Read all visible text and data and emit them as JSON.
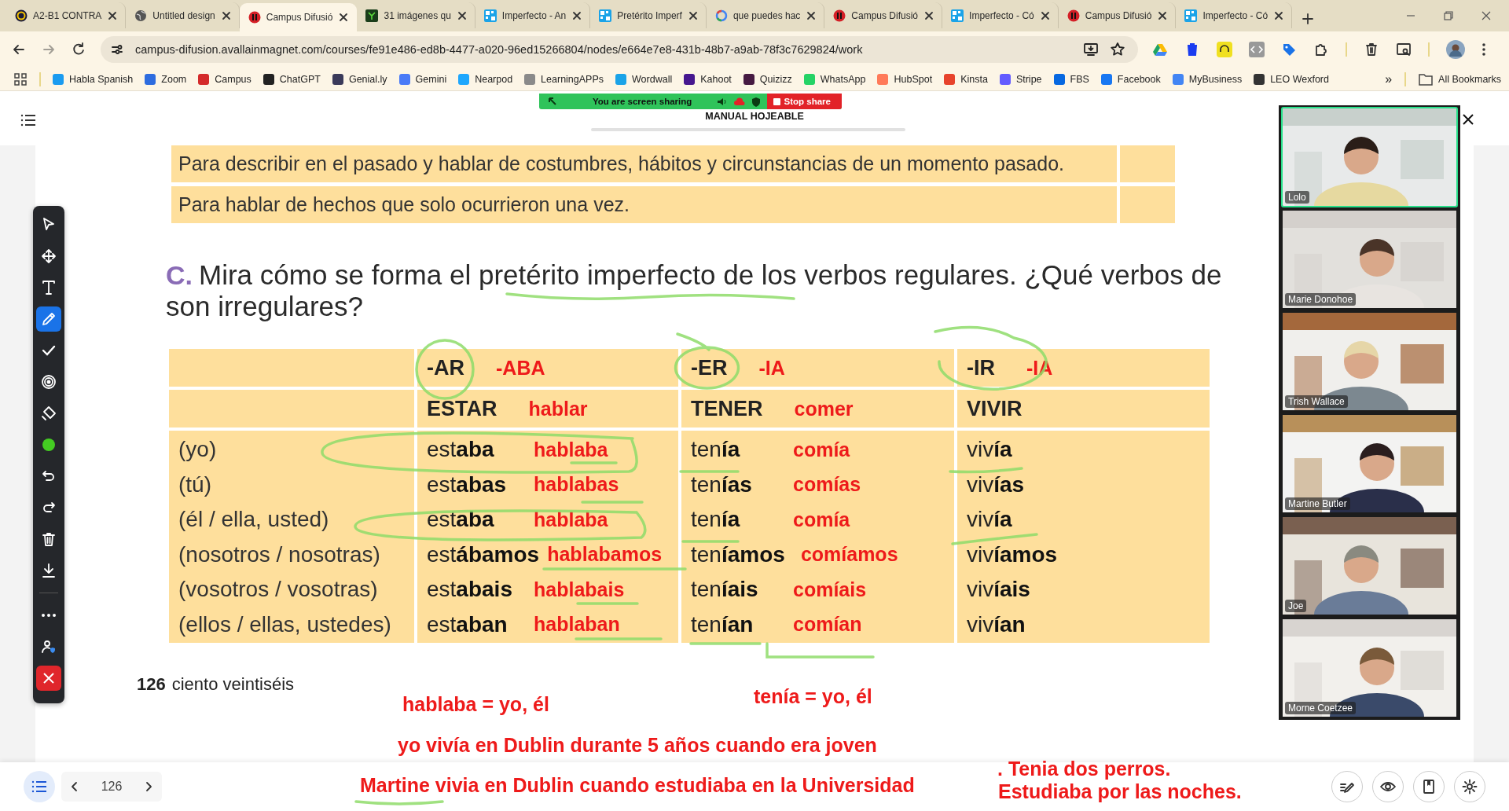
{
  "tabs": [
    {
      "title": "A2-B1 CONTRA",
      "kind": "ring",
      "selected": false
    },
    {
      "title": "Untitled design",
      "kind": "globe",
      "selected": false
    },
    {
      "title": "Campus Difusió",
      "kind": "campus",
      "selected": true
    },
    {
      "title": "31 imágenes qu",
      "kind": "network",
      "selected": false
    },
    {
      "title": "Imperfecto - An",
      "kind": "grid",
      "selected": false
    },
    {
      "title": "Pretérito Imperf",
      "kind": "grid",
      "selected": false
    },
    {
      "title": "que puedes hac",
      "kind": "search",
      "selected": false
    },
    {
      "title": "Campus Difusió",
      "kind": "campus",
      "selected": false
    },
    {
      "title": "Imperfecto - Có",
      "kind": "grid",
      "selected": false
    },
    {
      "title": "Campus Difusió",
      "kind": "campus",
      "selected": false
    },
    {
      "title": "Imperfecto - Có",
      "kind": "grid",
      "selected": false
    }
  ],
  "address_bar": {
    "url": "campus-difusion.avallainmagnet.com/courses/fe91e486-ed8b-4477-a020-96ed15266804/nodes/e664e7e8-431b-48b7-a9ab-78f3c7629824/work"
  },
  "bookmarks": [
    {
      "label": "Habla Spanish",
      "color": "#1a9bf0"
    },
    {
      "label": "Zoom",
      "color": "#2d6cdf"
    },
    {
      "label": "Campus",
      "color": "#d42a2a"
    },
    {
      "label": "ChatGPT",
      "color": "#222222"
    },
    {
      "label": "Genial.ly",
      "color": "#3a3a5a"
    },
    {
      "label": "Gemini",
      "color": "#4a7bf7"
    },
    {
      "label": "Nearpod",
      "color": "#1ea7fd"
    },
    {
      "label": "LearningAPPs",
      "color": "#8a8a8a"
    },
    {
      "label": "Wordwall",
      "color": "#1aa3e8"
    },
    {
      "label": "Kahoot",
      "color": "#46178f"
    },
    {
      "label": "Quizizz",
      "color": "#461a42"
    },
    {
      "label": "WhatsApp",
      "color": "#25d366"
    },
    {
      "label": "HubSpot",
      "color": "#ff7a59"
    },
    {
      "label": "Kinsta",
      "color": "#e7432c"
    },
    {
      "label": "Stripe",
      "color": "#635bff"
    },
    {
      "label": "FBS",
      "color": "#0668e1"
    },
    {
      "label": "Facebook",
      "color": "#1877f2"
    },
    {
      "label": "MyBusiness",
      "color": "#4285f4"
    },
    {
      "label": "LEO Wexford",
      "color": "#333333"
    }
  ],
  "bookmarks_more": "»",
  "all_bookmarks": "All Bookmarks",
  "share_bar": {
    "status": "You are screen sharing",
    "stop": "Stop share"
  },
  "viewer_title": "MANUAL HOJEABLE",
  "book": {
    "uses": [
      "Para describir en el pasado y hablar de costumbres, hábitos y circunstancias de un momento pasado.",
      "Para hablar de hechos que solo ocurrieron una vez."
    ],
    "exercise": {
      "letter": "C.",
      "lines": [
        "Mira cómo se forma el pretérito imperfecto de los verbos regulares. ¿Qué verbos de",
        "son irregulares?"
      ]
    },
    "conjugation": {
      "columns": [
        {
          "ending": "-AR",
          "note": "-ABA",
          "verb": "ESTAR",
          "verb_note": "hablar"
        },
        {
          "ending": "-ER",
          "note": "-IA",
          "verb": "TENER",
          "verb_note": "comer"
        },
        {
          "ending": "-IR",
          "note": "-IA",
          "verb": "VIVIR"
        }
      ],
      "rows": [
        {
          "person": "(yo)",
          "cells": [
            {
              "form": "est**aba**",
              "note": "hablaba"
            },
            {
              "form": "ten**ía**",
              "note": "comía"
            },
            {
              "form": "viv**ía**"
            }
          ]
        },
        {
          "person": "(tú)",
          "cells": [
            {
              "form": "est**abas**",
              "note": "hablabas"
            },
            {
              "form": "ten**ías**",
              "note": "comías"
            },
            {
              "form": "viv**ías**"
            }
          ]
        },
        {
          "person": "(él / ella, usted)",
          "cells": [
            {
              "form": "est**aba**",
              "note": "hablaba"
            },
            {
              "form": "ten**ía**",
              "note": "comía"
            },
            {
              "form": "viv**ía**"
            }
          ]
        },
        {
          "person": "(nosotros / nosotras)",
          "cells": [
            {
              "form": "est**ábamos**",
              "note": "hablabamos"
            },
            {
              "form": "ten**íamos**",
              "note": "comíamos"
            },
            {
              "form": "viv**íamos**"
            }
          ]
        },
        {
          "person": "(vosotros / vosotras)",
          "cells": [
            {
              "form": "est**abais**",
              "note": "hablabais"
            },
            {
              "form": "ten**íais**",
              "note": "comíais"
            },
            {
              "form": "viv**íais**"
            }
          ]
        },
        {
          "person": "(ellos / ellas, ustedes)",
          "cells": [
            {
              "form": "est**aban**",
              "note": "hablaban"
            },
            {
              "form": "ten**ían**",
              "note": "comían"
            },
            {
              "form": "viv**ían**"
            }
          ]
        }
      ]
    },
    "page_number": "126",
    "page_words": "ciento veintiséis"
  },
  "annotations": [
    {
      "text": "hablaba = yo, él"
    },
    {
      "text": "tenía = yo, él"
    },
    {
      "text": "yo vivía en Dublin durante 5 años cuando era joven"
    },
    {
      "text": "Martine vivia en Dublin cuando estudiaba en la Universidad"
    },
    {
      "text": ". Tenia dos perros."
    },
    {
      "text": "Estudiaba por las noches."
    }
  ],
  "tools": [
    {
      "kind": "pointer",
      "selected": false
    },
    {
      "kind": "move",
      "selected": false
    },
    {
      "kind": "text",
      "selected": false
    },
    {
      "kind": "pen",
      "selected": true
    },
    {
      "kind": "check",
      "selected": false
    },
    {
      "kind": "target",
      "selected": false
    },
    {
      "kind": "eraser",
      "selected": false
    },
    {
      "kind": "color",
      "selected": false,
      "color": "#44cc22"
    },
    {
      "kind": "undo",
      "selected": false
    },
    {
      "kind": "redo",
      "selected": false
    },
    {
      "kind": "trash",
      "selected": false
    },
    {
      "kind": "download",
      "selected": false
    },
    {
      "kind": "more",
      "selected": false
    },
    {
      "kind": "user",
      "selected": false
    },
    {
      "kind": "close",
      "selected": false
    }
  ],
  "participants": [
    {
      "name": "Lolo",
      "speaking": true
    },
    {
      "name": "Marie Donohoe",
      "speaking": false
    },
    {
      "name": "Trish Wallace",
      "speaking": false
    },
    {
      "name": "Martine Butler",
      "speaking": false
    },
    {
      "name": "Joe",
      "speaking": false
    },
    {
      "name": "Morne Coetzee",
      "speaking": false
    }
  ],
  "bottom_bar": {
    "page": "126"
  }
}
